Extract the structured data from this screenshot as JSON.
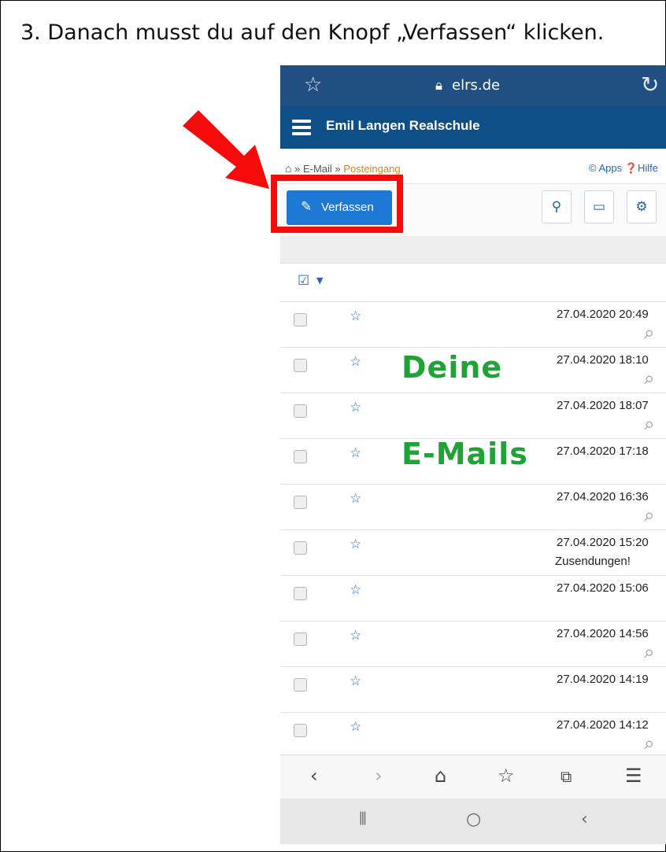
{
  "instruction": "3. Danach musst du auf den Knopf „Verfassen“ klicken.",
  "browser": {
    "url": "elrs.de",
    "star_icon": "star-outline-icon",
    "reload_icon": "reload-icon"
  },
  "site": {
    "title": "Emil Langen Realschule"
  },
  "breadcrumb": {
    "sep": "»",
    "email": "E-Mail",
    "inbox": "Posteingang",
    "apps": "Apps",
    "help": "Hilfe"
  },
  "toolbar": {
    "compose_label": "Verfassen"
  },
  "overlay": {
    "word1": "Deine",
    "word2": "E-Mails"
  },
  "messages": [
    {
      "date": "27.04.2020 20:49",
      "attachment": true,
      "subject": ""
    },
    {
      "date": "27.04.2020 18:10",
      "attachment": true,
      "subject": ""
    },
    {
      "date": "27.04.2020 18:07",
      "attachment": true,
      "subject": ""
    },
    {
      "date": "27.04.2020 17:18",
      "attachment": false,
      "subject": ""
    },
    {
      "date": "27.04.2020 16:36",
      "attachment": true,
      "subject": ""
    },
    {
      "date": "27.04.2020 15:20",
      "attachment": false,
      "subject": "Zusendungen!"
    },
    {
      "date": "27.04.2020 15:06",
      "attachment": false,
      "subject": ""
    },
    {
      "date": "27.04.2020 14:56",
      "attachment": true,
      "subject": ""
    },
    {
      "date": "27.04.2020 14:19",
      "attachment": false,
      "subject": ""
    },
    {
      "date": "27.04.2020 14:12",
      "attachment": true,
      "subject": ""
    }
  ],
  "colors": {
    "url_bar": "#224f82",
    "site_header": "#0f4f87",
    "compose_button": "#1e78d6",
    "highlight_box": "#f50a0a",
    "arrow": "#f50a0a",
    "overlay_text": "#1fa236"
  }
}
